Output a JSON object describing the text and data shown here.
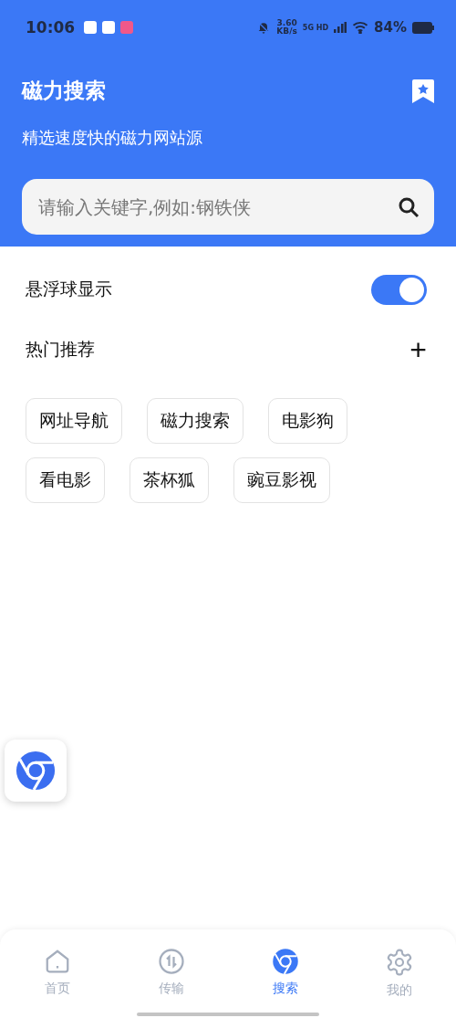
{
  "status_bar": {
    "time": "10:06",
    "speed_value": "3.60",
    "speed_unit": "KB/s",
    "network": "5G HD",
    "battery": "84%"
  },
  "header": {
    "title": "磁力搜索",
    "subtitle": "精选速度快的磁力网站源"
  },
  "search": {
    "placeholder": "请输入关键字,例如:钢铁侠"
  },
  "float_toggle": {
    "label": "悬浮球显示",
    "on": true
  },
  "hot": {
    "title": "热门推荐",
    "add": "+",
    "tags": [
      "网址导航",
      "磁力搜索",
      "电影狗",
      "看电影",
      "茶杯狐",
      "豌豆影视"
    ]
  },
  "nav": [
    {
      "kind": "home",
      "label": "首页",
      "selected": false
    },
    {
      "kind": "transfer",
      "label": "传输",
      "selected": false
    },
    {
      "kind": "search",
      "label": "搜索",
      "selected": true
    },
    {
      "kind": "settings",
      "label": "我的",
      "selected": false
    }
  ]
}
